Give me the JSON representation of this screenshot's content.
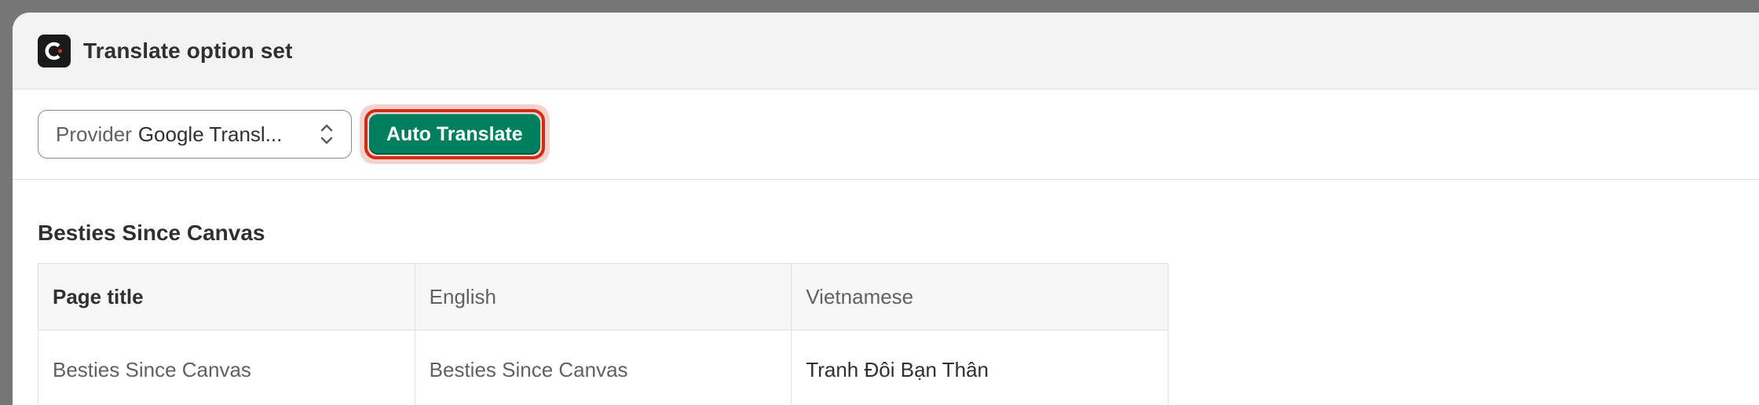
{
  "window": {
    "title": "Translate option set",
    "logo_icon": "app-logo-icon"
  },
  "toolbar": {
    "provider_label": "Provider",
    "provider_value": "Google Transl...",
    "auto_translate_label": "Auto Translate",
    "accent_color": "#007f5f",
    "highlight_color": "#d12c14"
  },
  "section": {
    "title": "Besties Since Canvas",
    "table": {
      "headers": [
        "Page title",
        "English",
        "Vietnamese"
      ],
      "rows": [
        [
          "Besties Since Canvas",
          "Besties Since Canvas",
          "Tranh Đôi Bạn Thân"
        ]
      ]
    }
  }
}
